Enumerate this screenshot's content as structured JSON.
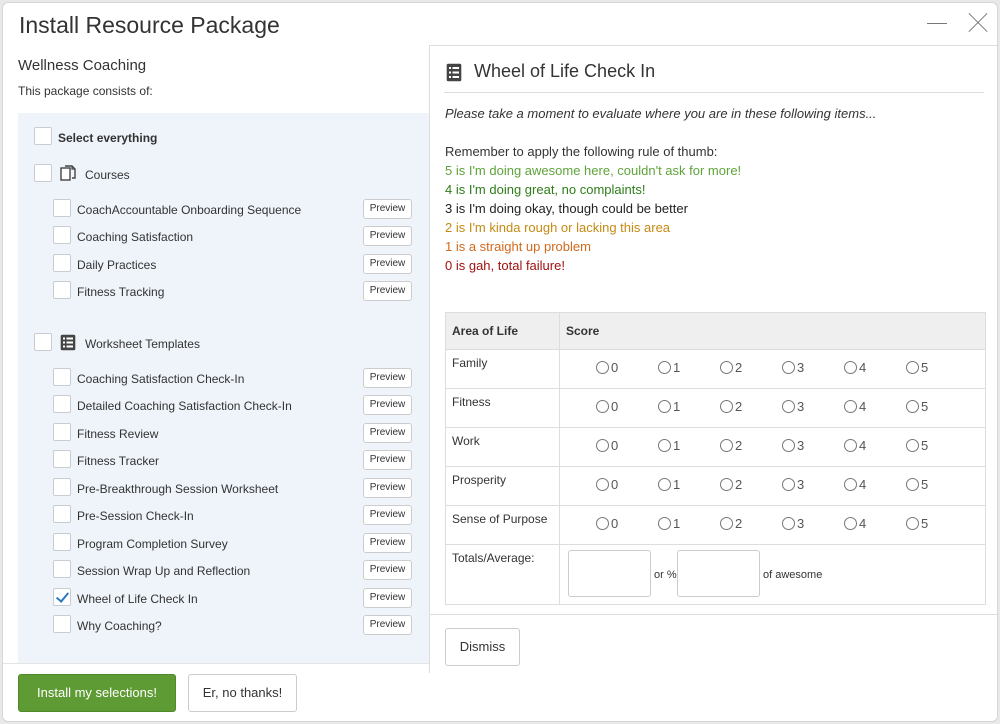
{
  "modal": {
    "title": "Install Resource Package"
  },
  "package": {
    "name": "Wellness Coaching",
    "subtitle": "This package consists of:",
    "select_all": "Select everything",
    "preview_label": "Preview",
    "groups": [
      {
        "label": "Courses",
        "icon": "document-copy-icon",
        "items": [
          {
            "label": "CoachAccountable Onboarding Sequence",
            "checked": false
          },
          {
            "label": "Coaching Satisfaction",
            "checked": false
          },
          {
            "label": "Daily Practices",
            "checked": false
          },
          {
            "label": "Fitness Tracking",
            "checked": false
          }
        ]
      },
      {
        "label": "Worksheet Templates",
        "icon": "worksheet-list-icon",
        "items": [
          {
            "label": "Coaching Satisfaction Check-In",
            "checked": false
          },
          {
            "label": "Detailed Coaching Satisfaction Check-In",
            "checked": false
          },
          {
            "label": "Fitness Review",
            "checked": false
          },
          {
            "label": "Fitness Tracker",
            "checked": false
          },
          {
            "label": "Pre-Breakthrough Session Worksheet",
            "checked": false
          },
          {
            "label": "Pre-Session Check-In",
            "checked": false
          },
          {
            "label": "Program Completion Survey",
            "checked": false
          },
          {
            "label": "Session Wrap Up and Reflection",
            "checked": false
          },
          {
            "label": "Wheel of Life Check In",
            "checked": true
          },
          {
            "label": "Why Coaching?",
            "checked": false
          }
        ]
      }
    ]
  },
  "footer": {
    "install_label": "Install my selections!",
    "decline_label": "Er, no thanks!"
  },
  "preview": {
    "title": "Wheel of Life Check In",
    "intro": "Please take a moment to evaluate where you are in these following items...",
    "rules": [
      {
        "text": "Remember to apply the following rule of thumb:",
        "color": "#333333"
      },
      {
        "text": "5 is I'm doing awesome here, couldn't ask for more!",
        "color": "#5fa33a"
      },
      {
        "text": "4 is I'm doing great, no complaints!",
        "color": "#2e7d19"
      },
      {
        "text": "3 is I'm doing okay, though could be better",
        "color": "#222222"
      },
      {
        "text": "2 is I'm kinda rough or lacking this area",
        "color": "#c48a12"
      },
      {
        "text": "1 is a straight up problem",
        "color": "#d2691e"
      },
      {
        "text": "0 is gah, total failure!",
        "color": "#a01010"
      }
    ],
    "table": {
      "col_area": "Area of Life",
      "col_score": "Score",
      "scores": [
        "0",
        "1",
        "2",
        "3",
        "4",
        "5"
      ],
      "rows": [
        "Family",
        "Fitness",
        "Work",
        "Prosperity",
        "Sense of Purpose"
      ],
      "totals_label": "Totals/Average:",
      "or_percent": "or %",
      "of_awesome": "of awesome"
    },
    "dismiss_label": "Dismiss"
  }
}
